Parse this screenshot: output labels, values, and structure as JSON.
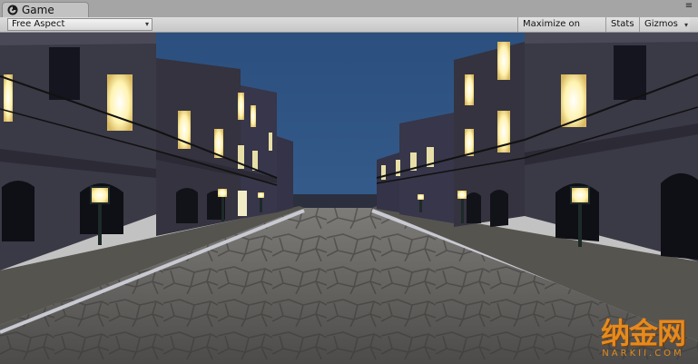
{
  "window": {
    "tab_title": "Game",
    "tab_icon": "unity-game-icon",
    "tab_menu_icon": "panel-menu-icon",
    "tab_menu_glyph": "≡"
  },
  "toolbar": {
    "aspect_label": "Free Aspect",
    "maximize_label": "Maximize on Play",
    "stats_label": "Stats",
    "gizmos_label": "Gizmos",
    "caret_glyph": "▾"
  },
  "scene": {
    "sky_color": "#2f527f",
    "building_color": "#3b3a47",
    "window_light_color": "#fff7c0",
    "road_color": "#6b6a67"
  },
  "watermark": {
    "main": "纳金网",
    "sub": "NARKII.COM"
  }
}
